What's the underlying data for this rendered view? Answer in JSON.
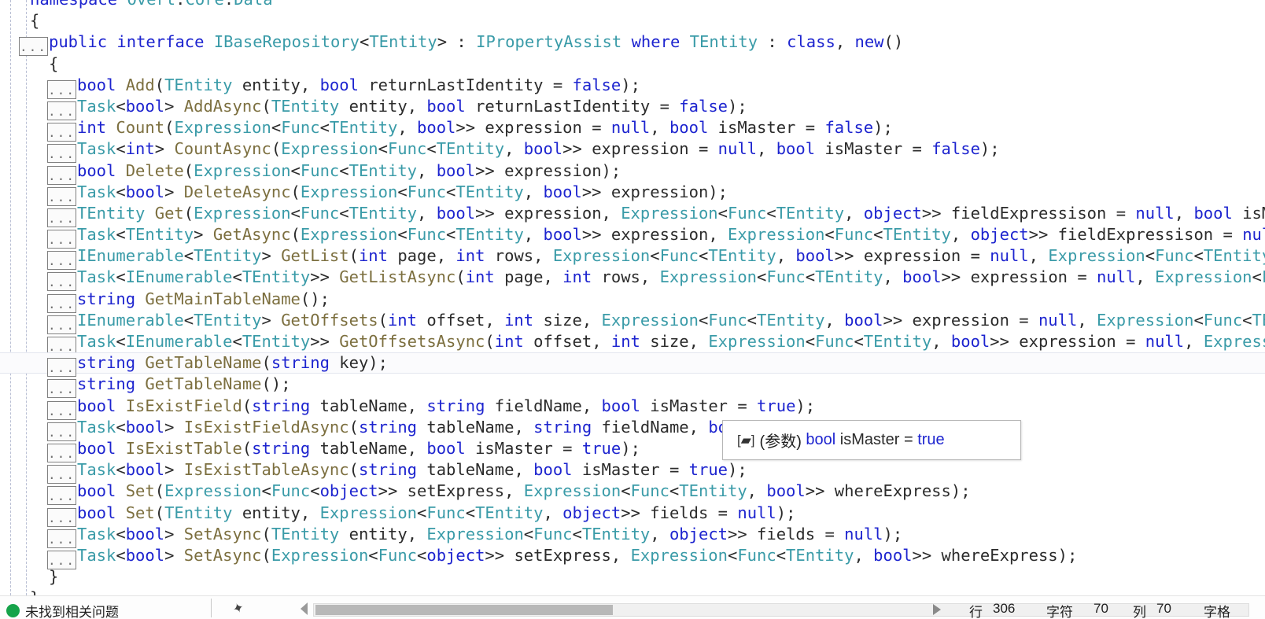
{
  "window": {
    "kind": "visual-studio-code-editor",
    "language": "C#"
  },
  "editor": {
    "namespace_line": "namespace Overt.Core.Data",
    "collapse_marker": "...",
    "current_line_index": 17,
    "colors": {
      "background": "#ffffff",
      "keyword": "#1d24cf",
      "type": "#3a9ba8",
      "method": "#7c6f3f",
      "identifier": "#2b2b2b",
      "selection_highlight": "#d6d6d6",
      "current_line_border": "#e4e6ef",
      "guide": "#b9bfd4"
    },
    "lines": [
      {
        "indent": 0,
        "fold": false,
        "text": "namespace Overt.Core.Data"
      },
      {
        "indent": 0,
        "fold": false,
        "text": "{"
      },
      {
        "indent": 1,
        "fold": true,
        "text": "public interface IBaseRepository<TEntity> : IPropertyAssist where TEntity : class, new()"
      },
      {
        "indent": 1,
        "fold": false,
        "text": "{"
      },
      {
        "indent": 2,
        "fold": true,
        "text": "bool Add(TEntity entity, bool returnLastIdentity = false);"
      },
      {
        "indent": 2,
        "fold": true,
        "text": "Task<bool> AddAsync(TEntity entity, bool returnLastIdentity = false);"
      },
      {
        "indent": 2,
        "fold": true,
        "text": "int Count(Expression<Func<TEntity, bool>> expression = null, bool isMaster = false);"
      },
      {
        "indent": 2,
        "fold": true,
        "text": "Task<int> CountAsync(Expression<Func<TEntity, bool>> expression = null, bool isMaster = false);"
      },
      {
        "indent": 2,
        "fold": true,
        "text": "bool Delete(Expression<Func<TEntity, bool>> expression);"
      },
      {
        "indent": 2,
        "fold": true,
        "text": "Task<bool> DeleteAsync(Expression<Func<TEntity, bool>> expression);"
      },
      {
        "indent": 2,
        "fold": true,
        "text": "TEntity Get(Expression<Func<TEntity, bool>> expression, Expression<Func<TEntity, object>> fieldExpressison = null, bool isMaster = false);"
      },
      {
        "indent": 2,
        "fold": true,
        "text": "Task<TEntity> GetAsync(Expression<Func<TEntity, bool>> expression, Expression<Func<TEntity, object>> fieldExpressison = null, bool isMaster = false);"
      },
      {
        "indent": 2,
        "fold": true,
        "text": "IEnumerable<TEntity> GetList(int page, int rows, Expression<Func<TEntity, bool>> expression = null, Expression<Func<TEntity, object>> fieldExpressison = null);"
      },
      {
        "indent": 2,
        "fold": true,
        "text": "Task<IEnumerable<TEntity>> GetListAsync(int page, int rows, Expression<Func<TEntity, bool>> expression = null, Expression<Func<TEntity, object>> fieldExpressison = null);"
      },
      {
        "indent": 2,
        "fold": true,
        "text": "string GetMainTableName();"
      },
      {
        "indent": 2,
        "fold": true,
        "text": "IEnumerable<TEntity> GetOffsets(int offset, int size, Expression<Func<TEntity, bool>> expression = null, Expression<Func<TEntity, object>> fieldExpressison = null);"
      },
      {
        "indent": 2,
        "fold": true,
        "text": "Task<IEnumerable<TEntity>> GetOffsetsAsync(int offset, int size, Expression<Func<TEntity, bool>> expression = null, Expression<Func<TEntity, object>> fieldExpressison = null);"
      },
      {
        "indent": 2,
        "fold": true,
        "text": "string GetTableName(string key);"
      },
      {
        "indent": 2,
        "fold": true,
        "text": "string GetTableName();"
      },
      {
        "indent": 2,
        "fold": true,
        "text": "bool IsExistField(string tableName, string fieldName, bool isMaster = true);"
      },
      {
        "indent": 2,
        "fold": true,
        "text": "Task<bool> IsExistFieldAsync(string tableName, string fieldName, bool isMaster = true);"
      },
      {
        "indent": 2,
        "fold": true,
        "text": "bool IsExistTable(string tableName, bool isMaster = true);"
      },
      {
        "indent": 2,
        "fold": true,
        "text": "Task<bool> IsExistTableAsync(string tableName, bool isMaster = true);"
      },
      {
        "indent": 2,
        "fold": true,
        "text": "bool Set(Expression<Func<object>> setExpress, Expression<Func<TEntity, bool>> whereExpress);"
      },
      {
        "indent": 2,
        "fold": true,
        "text": "bool Set(TEntity entity, Expression<Func<TEntity, object>> fields = null);"
      },
      {
        "indent": 2,
        "fold": true,
        "text": "Task<bool> SetAsync(TEntity entity, Expression<Func<TEntity, object>> fields = null);"
      },
      {
        "indent": 2,
        "fold": true,
        "text": "Task<bool> SetAsync(Expression<Func<object>> setExpress, Expression<Func<TEntity, bool>> whereExpress);"
      },
      {
        "indent": 1,
        "fold": false,
        "text": "}"
      },
      {
        "indent": 0,
        "fold": false,
        "text": "}"
      }
    ],
    "highlighted_token": "isMaster"
  },
  "tooltip": {
    "icon": "parameter-icon",
    "icon_glyph": "[▰]",
    "kind_label": "(参数)",
    "type": "bool",
    "name": "isMaster",
    "equals": "=",
    "value": "true",
    "full_text": "[▰] (参数) bool isMaster = true"
  },
  "statusbar": {
    "issues_text": "未找到相关问题",
    "issues_icon": "check-circle-icon",
    "pin_icon": "pin-icon",
    "line_label": "行",
    "line_value": "306",
    "char_label": "字符",
    "char_value": "70",
    "col_label": "列",
    "col_value": "70",
    "insert_mode": "字格"
  }
}
